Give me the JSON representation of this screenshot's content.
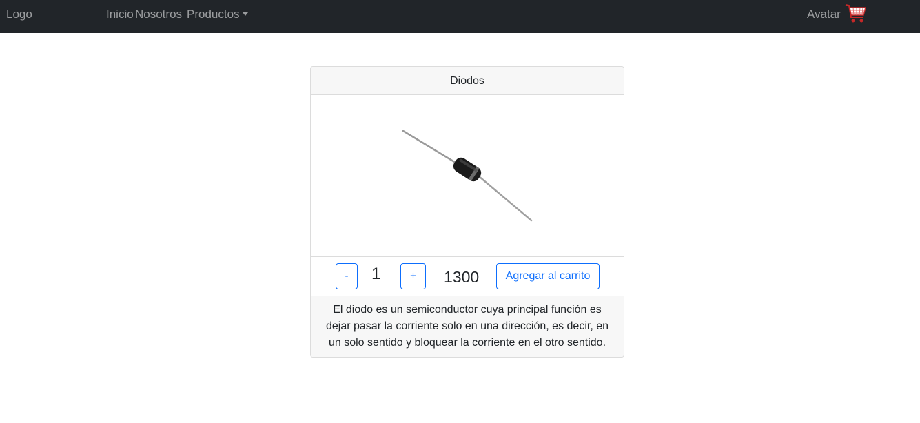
{
  "navbar": {
    "logo": "Logo",
    "links": [
      "Inicio",
      "Nosotros",
      "Productos"
    ],
    "avatar": "Avatar",
    "cart_icon": "shopping-cart-icon"
  },
  "product": {
    "title": "Diodos",
    "image": "diode-image",
    "decrement_label": "-",
    "quantity": "1",
    "increment_label": "+",
    "price": "1300",
    "add_to_cart_label": "Agregar al carrito",
    "description": "El diodo es un semiconductor cuya principal función es dejar pasar la corriente solo en una dirección, es decir, en un solo sentido y bloquear la corriente en el otro sentido."
  },
  "colors": {
    "navbar_bg": "#212529",
    "accent": "#0d6efd",
    "cart_icon": "#d32f2f"
  }
}
